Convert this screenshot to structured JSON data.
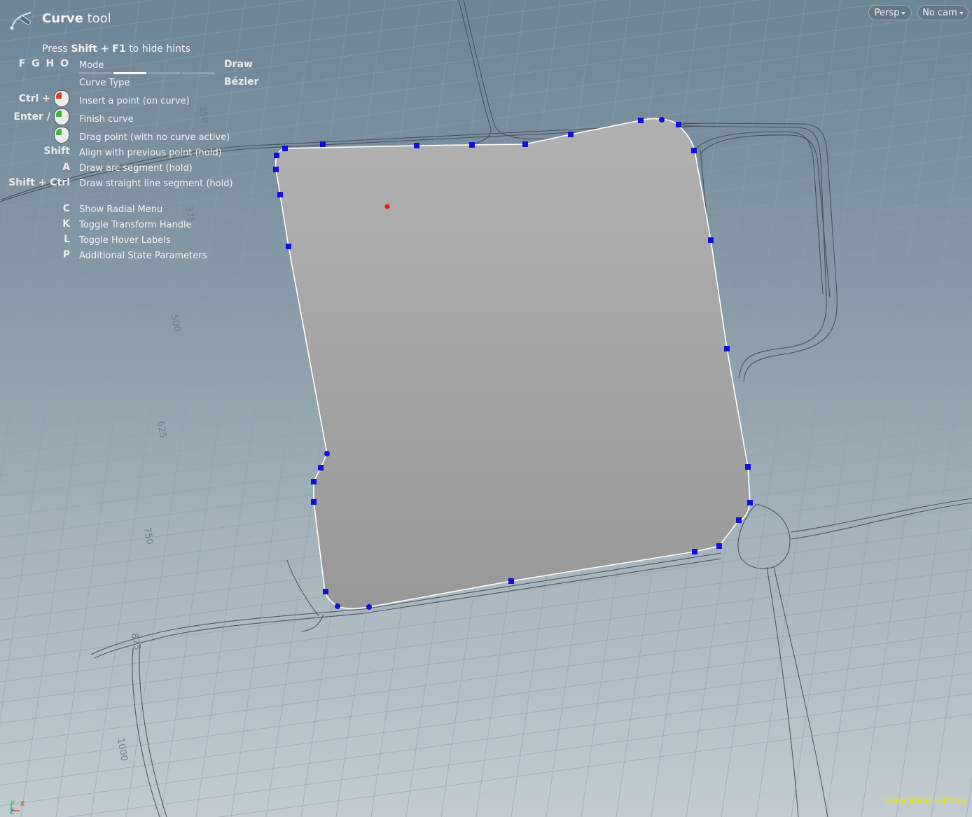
{
  "tool": {
    "name": "Curve",
    "suffix": "tool",
    "icon": "curve-tool-icon"
  },
  "hint_line": {
    "prefix": "Press",
    "keys": "Shift + F1",
    "suffix": "to hide hints"
  },
  "modes": {
    "keys": "F G H O",
    "label": "Mode",
    "value": "Draw",
    "selected_index": 0,
    "count": 3
  },
  "curve_type": {
    "label": "Curve Type",
    "value": "Bézier"
  },
  "hints": [
    {
      "key": "Ctrl +",
      "mouse": "left-red",
      "label": "Insert a point (on curve)"
    },
    {
      "key": "Enter /",
      "mouse": "left-green",
      "label": "Finish curve"
    },
    {
      "key": "",
      "mouse": "left-green",
      "label": "Drag point (with no curve active)"
    },
    {
      "key": "Shift",
      "label": "Align with previous point (hold)"
    },
    {
      "key": "A",
      "label": "Draw arc segment (hold)"
    },
    {
      "key": "Shift + Ctrl",
      "label": "Draw straight line segment (hold)"
    },
    {
      "key": "C",
      "label": "Show Radial Menu"
    },
    {
      "key": "K",
      "label": "Toggle Transform Handle"
    },
    {
      "key": "L",
      "label": "Toggle Hover Labels"
    },
    {
      "key": "P",
      "label": "Additional State Parameters"
    }
  ],
  "view_menu": {
    "projection": "Persp",
    "camera": "No cam"
  },
  "grid_labels": [
    "250",
    "375",
    "500",
    "625",
    "750",
    "875",
    "1000"
  ],
  "axes": {
    "y": "Y",
    "x": "X",
    "z": "Z"
  },
  "watermark": "Education Edition",
  "colors": {
    "shape_fill": "#a3a3a3",
    "control_point": "#1010d8",
    "origin_marker": "#e02010",
    "watermark": "#e8e800"
  }
}
